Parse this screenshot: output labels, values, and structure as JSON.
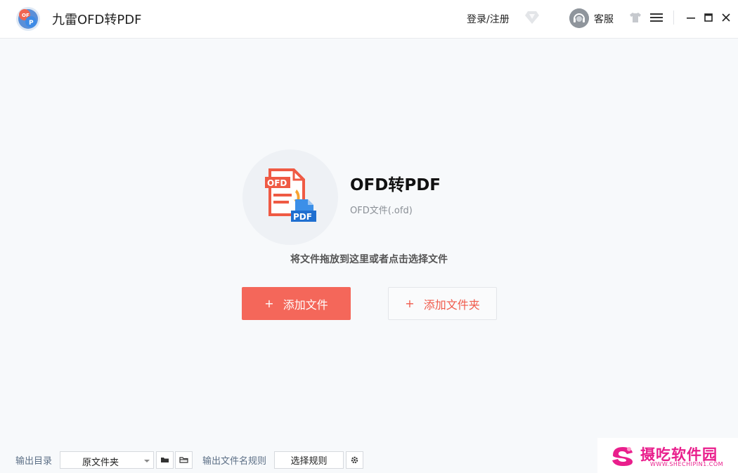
{
  "titlebar": {
    "app_title": "九雷OFD转PDF",
    "login_label": "登录/注册",
    "customer_service_label": "客服",
    "icons": [
      "app-logo-icon",
      "vip-diamond-icon",
      "headset-avatar-icon",
      "skin-shirt-icon",
      "menu-icon",
      "minimize-icon",
      "maximize-icon",
      "close-icon"
    ]
  },
  "main": {
    "converter_title": "OFD转PDF",
    "file_type": "OFD文件(.ofd)",
    "illustration": {
      "badge_from": "OFD",
      "badge_to": "PDF"
    },
    "drop_hint": "将文件拖放到这里或者点击选择文件",
    "add_file": {
      "plus": "+",
      "label": "添加文件"
    },
    "add_folder": {
      "plus": "+",
      "label": "添加文件夹"
    }
  },
  "footer": {
    "output_dir_label": "输出目录",
    "output_dir_value": "原文件夹",
    "filename_rule_label": "输出文件名规则",
    "choose_rule_label": "选择规则"
  },
  "watermark": {
    "text": "摄吃软件园",
    "sub": "WWW.SHECHIPIN1.COM"
  },
  "colors": {
    "accent": "#f4675a",
    "accent_text": "#f05a4b",
    "background": "#f7f9fb",
    "watermark": "#e91e8c"
  }
}
